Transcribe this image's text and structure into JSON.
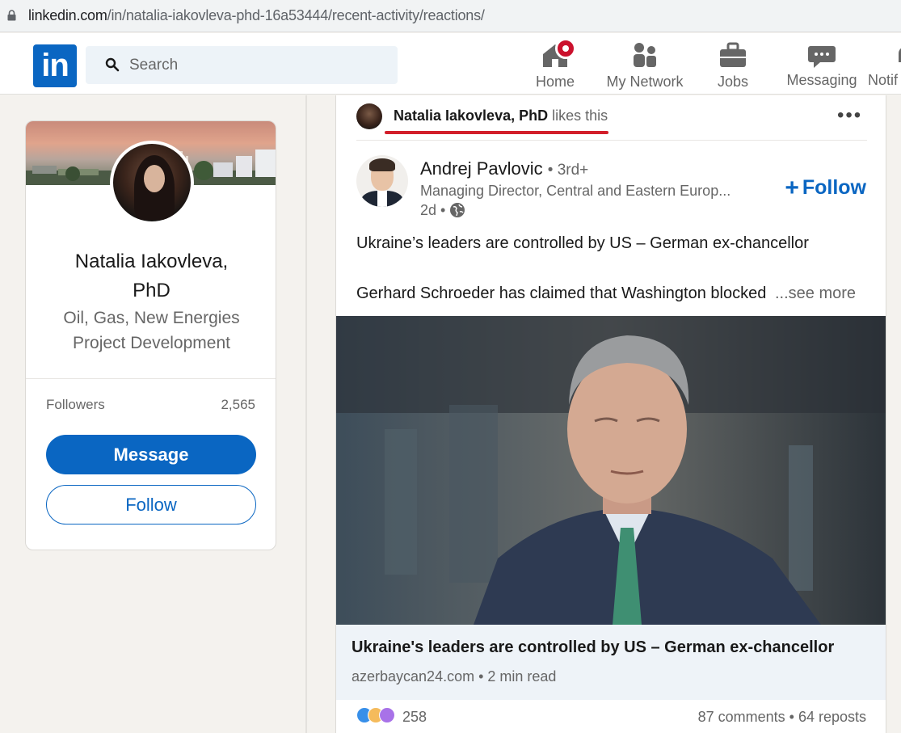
{
  "browser": {
    "url_host": "linkedin.com",
    "url_path": "/in/natalia-iakovleva-phd-16a53444/recent-activity/reactions/"
  },
  "nav": {
    "logo": "in",
    "search_placeholder": "Search",
    "items": [
      {
        "label": "Home",
        "icon": "home-icon"
      },
      {
        "label": "My Network",
        "icon": "network-icon"
      },
      {
        "label": "Jobs",
        "icon": "briefcase-icon"
      },
      {
        "label": "Messaging",
        "icon": "messaging-icon"
      },
      {
        "label": "Notif",
        "icon": "bell-icon"
      }
    ]
  },
  "profile": {
    "name_line1": "Natalia Iakovleva,",
    "name_line2": "PhD",
    "headline_line1": "Oil, Gas, New Energies",
    "headline_line2": "Project Development",
    "followers_label": "Followers",
    "followers_count": "2,565",
    "message_label": "Message",
    "follow_label": "Follow"
  },
  "post": {
    "liker_name": "Natalia Iakovleva, PhD",
    "liker_action": "likes this",
    "author_name": "Andrej Pavlovic",
    "author_degree": "• 3rd+",
    "author_title": "Managing Director, Central and Eastern Europ...",
    "time": "2d •",
    "follow_label": "Follow",
    "text_line1": "Ukraine’s leaders are controlled by US – German ex-chancellor",
    "text_line2": "Gerhard Schroeder has claimed that Washington blocked",
    "see_more": "...see more",
    "article_title": "Ukraine's leaders are controlled by US – German ex-chancellor",
    "article_meta": "azerbaycan24.com • 2 min read",
    "reaction_count": "258",
    "comments_reposts": "87 comments • 64 reposts"
  },
  "colors": {
    "brand": "#0a66c2",
    "notification": "#cb112d",
    "annotation_underline": "#d21f2b"
  }
}
